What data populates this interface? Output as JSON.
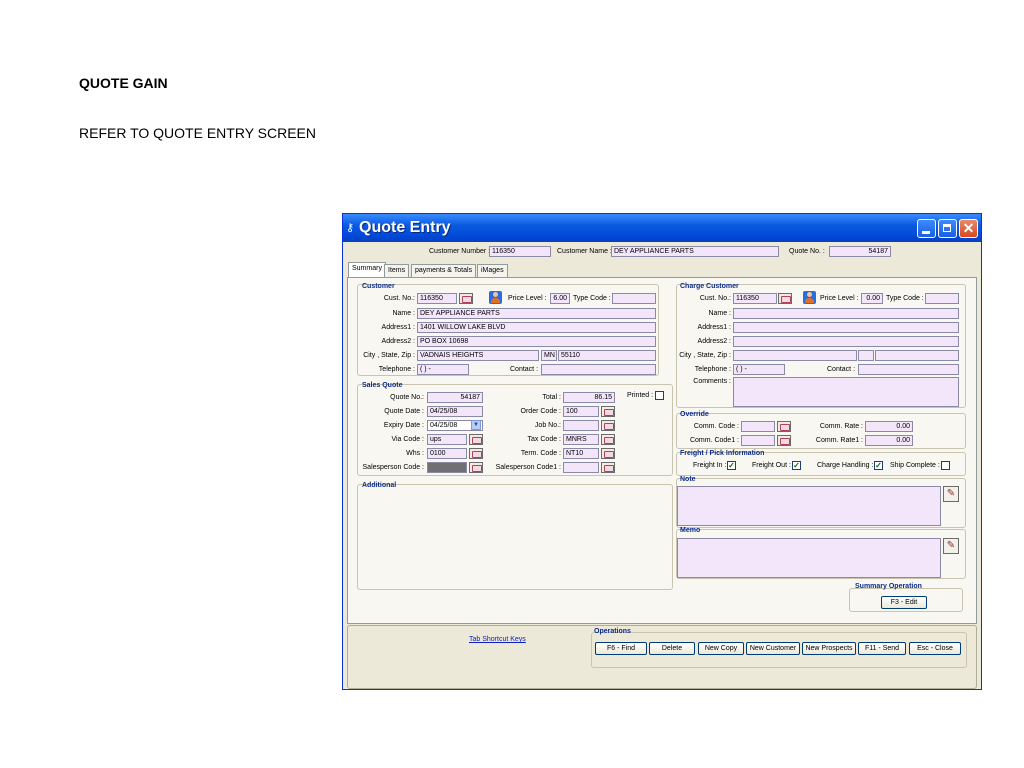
{
  "slide": {
    "title": "QUOTE GAIN",
    "subtitle": "REFER TO QUOTE ENTRY SCREEN"
  },
  "window": {
    "title": "Quote Entry"
  },
  "header": {
    "customer_number_label": "Customer Number :",
    "customer_number": "116350",
    "customer_name_label": "Customer Name :",
    "customer_name": "DEY APPLIANCE PARTS",
    "quote_no_label": "Quote No. :",
    "quote_no": "54187"
  },
  "tabs": [
    "Summary",
    "Items",
    "payments & Totals",
    "iMages"
  ],
  "customer": {
    "title": "Customer",
    "cust_no_label": "Cust. No.:",
    "cust_no": "116350",
    "price_level_label": "Price Level :",
    "price_level": "6.00",
    "type_code_label": "Type Code :",
    "type_code": "",
    "name_label": "Name :",
    "name": "DEY APPLIANCE PARTS",
    "address1_label": "Address1 :",
    "address1": "1401 WILLOW LAKE BLVD",
    "address2_label": "Address2 :",
    "address2": "PO  BOX 10698",
    "city_label": "City , State, Zip :",
    "city": "VADNAIS HEIGHTS",
    "state": "MN",
    "zip": "55110",
    "telephone_label": "Telephone :",
    "telephone": "(  )   -",
    "contact_label": "Contact :",
    "contact": ""
  },
  "charge": {
    "title": "Charge Customer",
    "cust_no_label": "Cust. No.:",
    "cust_no": "116350",
    "price_level_label": "Price Level :",
    "price_level": "0.00",
    "type_code_label": "Type Code :",
    "name_label": "Name :",
    "address1_label": "Address1 :",
    "address2_label": "Address2 :",
    "city_label": "City , State, Zip :",
    "telephone_label": "Telephone :",
    "telephone": "(  )   -",
    "contact_label": "Contact :",
    "comments_label": "Comments :"
  },
  "sales_quote": {
    "title": "Sales Quote",
    "quote_no_label": "Quote No.:",
    "quote_no": "54187",
    "quote_date_label": "Quote Date :",
    "quote_date": "04/25/08",
    "expiry_date_label": "Expiry Date :",
    "expiry_date": "04/25/08",
    "via_code_label": "Via Code :",
    "via_code": "ups",
    "whs_label": "Whs :",
    "whs": "0100",
    "salesperson_label": "Salesperson Code :",
    "total_label": "Total :",
    "total": "86.15",
    "printed_label": "Printed :",
    "order_code_label": "Order Code :",
    "order_code": "100",
    "job_no_label": "Job No.:",
    "tax_code_label": "Tax Code :",
    "tax_code": "MNRS",
    "term_code_label": "Term. Code :",
    "term_code": "NT10",
    "salesperson1_label": "Salesperson Code1 :"
  },
  "override": {
    "title": "Override",
    "comm_code_label": "Comm. Code :",
    "comm_code1_label": "Comm. Code1 :",
    "comm_rate_label": "Comm. Rate :",
    "comm_rate": "0.00",
    "comm_rate1_label": "Comm. Rate1 :",
    "comm_rate1": "0.00"
  },
  "freight": {
    "title": "Freight / Pick Information",
    "freight_in_label": "Freight In :",
    "freight_out_label": "Freight Out :",
    "charge_handling_label": "Charge Handling :",
    "ship_complete_label": "Ship Complete :"
  },
  "additional": {
    "title": "Additional"
  },
  "note": {
    "title": "Note"
  },
  "memo": {
    "title": "Memo"
  },
  "summary_operation": {
    "title": "Summary Operation",
    "edit_label": "F3 - Edit"
  },
  "operations": {
    "title": "Operations",
    "shortcut_link": "Tab Shortcut Keys",
    "buttons": [
      "F6 - Find",
      "Delete",
      "New Copy",
      "New Customer",
      "New Prospects",
      "F11 - Send",
      "Esc - Close"
    ]
  }
}
